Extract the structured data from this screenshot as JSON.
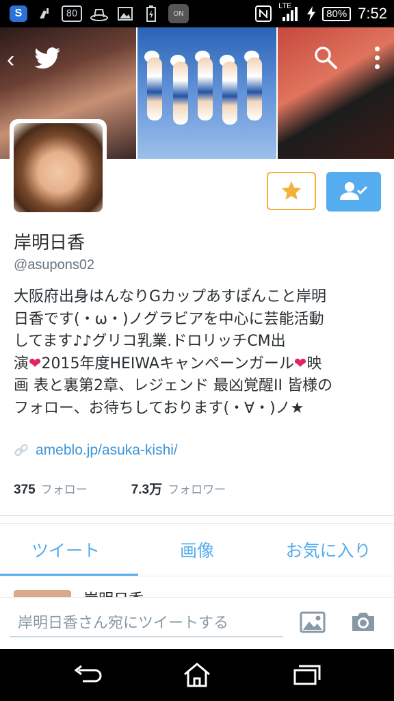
{
  "status_bar": {
    "left_icons": [
      "s-app-icon",
      "cleaner-icon",
      "speed-80-icon",
      "hat-icon",
      "gallery-icon",
      "battery-charging-icon",
      "nfc-on-icon"
    ],
    "speed_label": "80",
    "nfc_label": "ON",
    "lte": "LTE",
    "battery": "80%",
    "time": "7:52"
  },
  "profile": {
    "name": "岸明日香",
    "handle": "@asupons02",
    "bio_lines": [
      "大阪府出身はんなりGカップあすぽんこと岸明",
      "日香です(・ω・)ノグラビアを中心に芸能活動",
      "してます♪♪グリコ乳業.ドロリッチCM出",
      "演❤2015年度HEIWAキャンペーンガール❤映",
      "画 表と裏第2章、レジェンド 最凶覚醒II 皆様の",
      "フォロー、お待ちしております(・∀・)ノ★"
    ],
    "link": "ameblo.jp/asuka-kishi/",
    "following_count": "375",
    "following_label": "フォロー",
    "followers_count": "7.3万",
    "followers_label": "フォロワー"
  },
  "tabs": [
    {
      "label": "ツイート",
      "active": true
    },
    {
      "label": "画像",
      "active": false
    },
    {
      "label": "お気に入り",
      "active": false
    }
  ],
  "peek_row": {
    "name": "岸明日香"
  },
  "compose": {
    "placeholder": "岸明日香さん宛にツイートする"
  },
  "colors": {
    "accent": "#55acee",
    "star": "#f2b13a",
    "link": "#3b94d9",
    "heart": "#e0245e"
  }
}
